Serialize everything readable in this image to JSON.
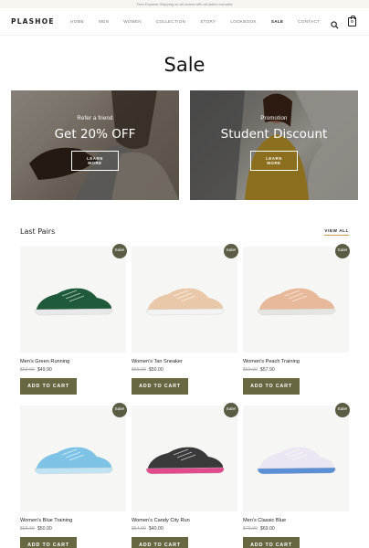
{
  "topbar": {
    "text": "Free Express Shipping on all orders with all duties included"
  },
  "header": {
    "logo": "PLASHOE",
    "nav": [
      "HOME",
      "MEN",
      "WOMEN",
      "COLLECTION",
      "STORY",
      "LOOKBOOK",
      "SALE",
      "CONTACT"
    ],
    "active_nav": "SALE",
    "cart_count": "0",
    "icons": {
      "search": "search-icon",
      "cart": "shopping-bag-icon"
    }
  },
  "page": {
    "title": "Sale"
  },
  "banners": [
    {
      "kicker": "Refer a friend",
      "headline": "Get 20% OFF",
      "button": "LEARN MORE"
    },
    {
      "kicker": "Promotion",
      "headline": "Student Discount",
      "button": "LEARN MORE"
    }
  ],
  "section": {
    "title": "Last Pairs",
    "view_all": "VIEW ALL"
  },
  "products": [
    {
      "badge": "Sale!",
      "name": "Men's Green Running",
      "old_price": "$59.90",
      "price": "$49.90",
      "button": "ADD TO CART",
      "color": "#1f5a3a",
      "sole": "#e8e8e8"
    },
    {
      "badge": "Sale!",
      "name": "Women's Tan Sneaker",
      "old_price": "$55.90",
      "price": "$50.00",
      "button": "ADD TO CART",
      "color": "#e8c8a8",
      "sole": "#f3f3f3"
    },
    {
      "badge": "Sale!",
      "name": "Women's Peach Training",
      "old_price": "$59.90",
      "price": "$57.90",
      "button": "ADD TO CART",
      "color": "#e8b89a",
      "sole": "#e4e4e0"
    },
    {
      "badge": "Sale!",
      "name": "Women's Blue Training",
      "old_price": "$58.90",
      "price": "$50.00",
      "button": "ADD TO CART",
      "color": "#7ec2e6",
      "sole": "#bfe3f2"
    },
    {
      "badge": "Sale!",
      "name": "Women's Candy City Run",
      "old_price": "$54.90",
      "price": "$40.00",
      "button": "ADD TO CART",
      "color": "#3a3a3a",
      "sole": "#e24a8e"
    },
    {
      "badge": "Sale!",
      "name": "Men's Classic Blue",
      "old_price": "$79.90",
      "price": "$69.00",
      "button": "ADD TO CART",
      "color": "#ebe6f2",
      "sole": "#5a8fd6"
    }
  ]
}
